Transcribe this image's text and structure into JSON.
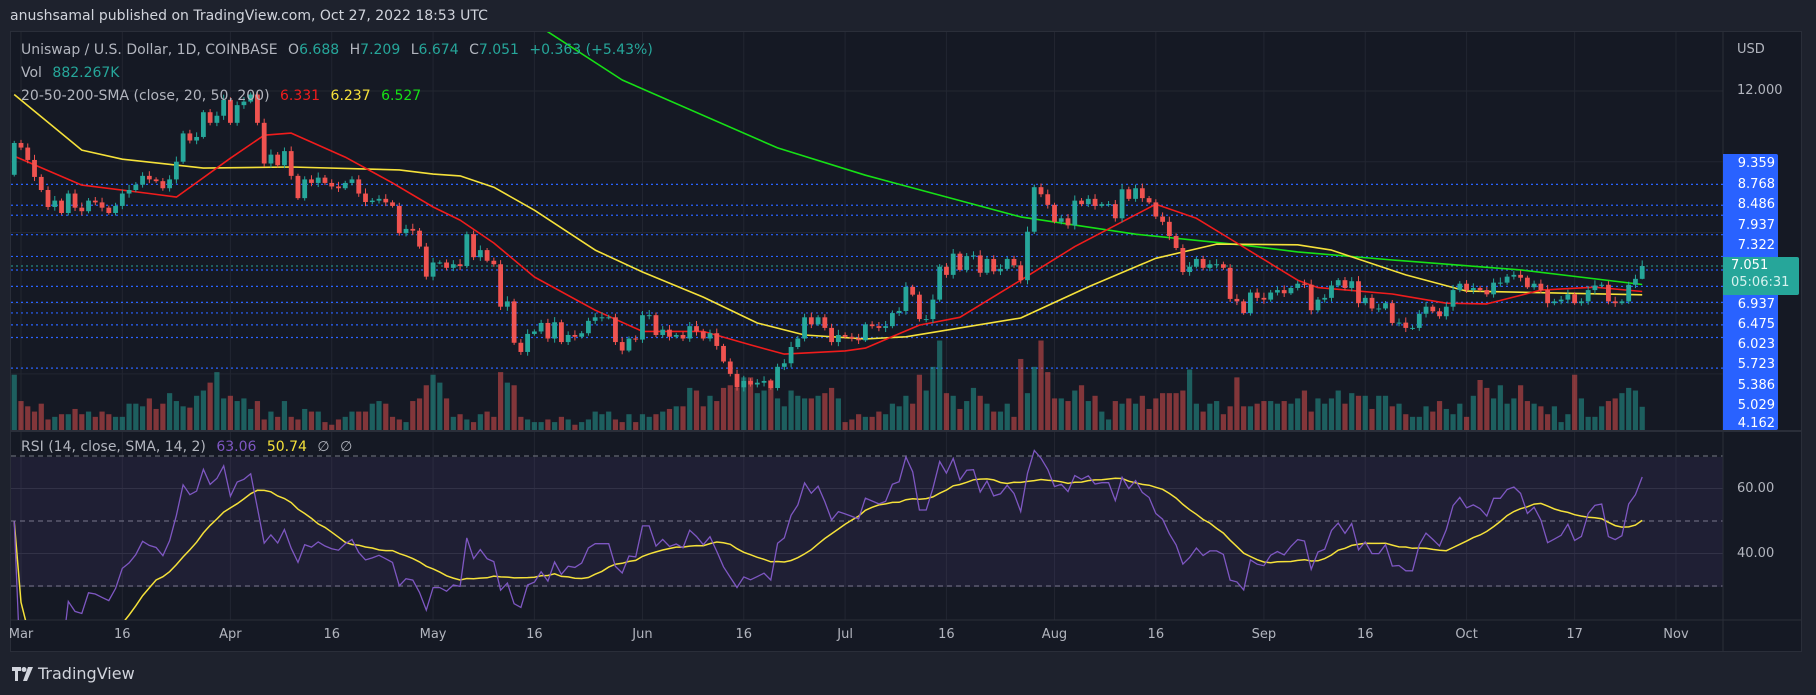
{
  "header": {
    "published": "anushsamal published on TradingView.com, Oct 27, 2022 18:53 UTC"
  },
  "legend": {
    "symbol": "Uniswap / U.S. Dollar, 1D, COINBASE",
    "o_label": "O",
    "o": "6.688",
    "h_label": "H",
    "h": "7.209",
    "l_label": "L",
    "l": "6.674",
    "c_label": "C",
    "c": "7.051",
    "change": "+0.363 (+5.43%)",
    "vol_label": "Vol",
    "vol": "882.267K",
    "sma_label": "20-50-200-SMA (close, 20, 50, 200)",
    "sma20": "6.331",
    "sma50": "6.237",
    "sma200": "6.527",
    "rsi_label": "RSI (14, close, SMA, 14, 2)",
    "rsi": "63.06",
    "rsi_ma": "50.74",
    "rsi_extra1": "∅",
    "rsi_extra2": "∅"
  },
  "price_axis": {
    "currency": "USD",
    "tick": "12.000",
    "line_labels": [
      "9.359",
      "8.768",
      "8.486",
      "7.937",
      "7.322",
      "6.937",
      "6.475",
      "6.023",
      "5.723",
      "5.386",
      "5.029",
      "4.162"
    ],
    "current_price": "7.051",
    "countdown": "05:06:31"
  },
  "rsi_axis": {
    "ticks": [
      "60.00",
      "40.00"
    ]
  },
  "footer": {
    "logo_text": "TradingView"
  },
  "colors": {
    "up": "#26a69a",
    "down": "#ef5350",
    "sma20": "#f01c1c",
    "sma50": "#f5e13a",
    "sma200": "#16e016",
    "rsi": "#7e57c2",
    "rsi_ma": "#f5e13a",
    "hline": "#2962ff"
  },
  "chart_data": {
    "type": "candlestick",
    "title": "Uniswap / U.S. Dollar, 1D, COINBASE",
    "scale": "linear",
    "ylim": [
      2.4,
      13.6
    ],
    "start_date": "2022-02-28",
    "last": {
      "open": 6.688,
      "high": 7.209,
      "low": 6.674,
      "close": 7.051
    },
    "closes": [
      10.53,
      10.4,
      10.05,
      9.57,
      9.2,
      8.72,
      8.9,
      8.55,
      9.1,
      8.7,
      8.6,
      8.9,
      8.85,
      8.7,
      8.55,
      8.75,
      9.1,
      9.2,
      9.35,
      9.6,
      9.5,
      9.45,
      9.25,
      9.5,
      10.0,
      10.8,
      10.6,
      10.7,
      11.4,
      11.1,
      11.3,
      11.75,
      11.1,
      11.6,
      11.7,
      11.9,
      11.1,
      9.95,
      10.2,
      9.9,
      10.3,
      9.6,
      8.97,
      9.5,
      9.4,
      9.55,
      9.4,
      9.3,
      9.25,
      9.4,
      9.5,
      9.1,
      8.86,
      8.9,
      8.95,
      8.85,
      8.75,
      7.98,
      8.1,
      8.05,
      7.6,
      6.75,
      7.15,
      7.15,
      7.0,
      7.1,
      7.05,
      7.95,
      7.3,
      7.5,
      7.2,
      7.1,
      5.9,
      6.05,
      4.88,
      4.62,
      5.13,
      5.2,
      5.44,
      5.0,
      5.46,
      4.9,
      5.1,
      5.05,
      5.15,
      5.5,
      5.6,
      5.6,
      5.6,
      4.9,
      4.66,
      5.0,
      4.97,
      5.66,
      5.66,
      5.1,
      5.25,
      5.05,
      5.1,
      5.0,
      5.35,
      5.2,
      5.0,
      5.15,
      4.79,
      4.35,
      4.0,
      3.62,
      3.8,
      3.7,
      3.75,
      3.8,
      3.6,
      4.2,
      4.3,
      4.76,
      5.0,
      5.6,
      5.4,
      5.6,
      5.3,
      4.9,
      5.1,
      5.05,
      5.0,
      4.95,
      5.4,
      5.35,
      5.3,
      5.35,
      5.72,
      5.78,
      6.46,
      6.24,
      5.55,
      5.55,
      6.1,
      7.03,
      6.8,
      7.4,
      6.94,
      7.33,
      7.35,
      6.86,
      7.25,
      6.9,
      6.97,
      7.25,
      7.07,
      6.65,
      8.02,
      9.28,
      9.08,
      8.78,
      8.3,
      8.4,
      8.2,
      8.9,
      8.8,
      8.95,
      8.75,
      8.8,
      8.8,
      8.4,
      9.22,
      8.95,
      9.25,
      8.97,
      8.85,
      8.45,
      8.3,
      7.9,
      7.56,
      6.88,
      7.03,
      7.25,
      7.0,
      7.1,
      7.1,
      7.0,
      6.12,
      6.05,
      5.72,
      6.3,
      6.15,
      6.1,
      6.3,
      6.37,
      6.28,
      6.43,
      6.55,
      6.52,
      5.8,
      6.1,
      6.15,
      6.5,
      6.65,
      6.43,
      6.62,
      6.0,
      6.15,
      5.85,
      5.85,
      6.0,
      5.44,
      5.45,
      5.3,
      5.3,
      5.7,
      5.9,
      5.77,
      5.63,
      5.9,
      6.37,
      6.55,
      6.37,
      6.43,
      6.37,
      6.25,
      6.58,
      6.58,
      6.75,
      6.8,
      6.72,
      6.45,
      6.55,
      6.37,
      6.0,
      6.05,
      6.1,
      6.25,
      6.0,
      6.05,
      6.37,
      6.5,
      6.52,
      6.05,
      6.0,
      6.05,
      6.52,
      6.688,
      7.051
    ],
    "volume_k": [
      2100,
      1100,
      900,
      700,
      1000,
      400,
      500,
      600,
      600,
      800,
      600,
      700,
      500,
      700,
      600,
      500,
      500,
      1000,
      1000,
      900,
      1200,
      800,
      1000,
      1400,
      1100,
      900,
      850,
      1300,
      1500,
      1800,
      2200,
      1200,
      1300,
      1100,
      1200,
      800,
      1100,
      400,
      700,
      500,
      1100,
      500,
      400,
      800,
      700,
      700,
      300,
      200,
      400,
      500,
      700,
      700,
      700,
      1000,
      1100,
      1000,
      500,
      400,
      300,
      1100,
      1200,
      1700,
      2100,
      1800,
      1200,
      500,
      600,
      400,
      300,
      600,
      700,
      500,
      2200,
      1800,
      1700,
      500,
      400,
      300,
      300,
      400,
      300,
      500,
      400,
      200,
      300,
      400,
      700,
      600,
      700,
      400,
      300,
      600,
      300,
      600,
      500,
      600,
      700,
      800,
      900,
      900,
      1600,
      1500,
      900,
      1300,
      1100,
      1600,
      1700,
      1600,
      2000,
      2000,
      1400,
      1500,
      1900,
      1200,
      900,
      1500,
      1300,
      1200,
      1200,
      1300,
      1400,
      1600,
      1200,
      300,
      400,
      600,
      500,
      500,
      700,
      600,
      1000,
      900,
      1300,
      1000,
      2100,
      1500,
      2400,
      3400,
      1400,
      1300,
      800,
      1100,
      1600,
      1300,
      1000,
      700,
      700,
      1000,
      500,
      2700,
      1400,
      2400,
      3400,
      2200,
      1200,
      1200,
      1100,
      1500,
      1700,
      1100,
      1300,
      700,
      400,
      1100,
      1000,
      1200,
      1000,
      1300,
      800,
      1200,
      1400,
      1400,
      1400,
      1500,
      2300,
      1000,
      700,
      1000,
      1100,
      600,
      900,
      2000,
      900,
      900,
      1000,
      1100,
      1100,
      1000,
      1100,
      1000,
      1200,
      1500,
      700,
      1200,
      1000,
      1200,
      1500,
      1000,
      1400,
      1300,
      1300,
      800,
      1300,
      1300,
      900,
      1000,
      600,
      500,
      500,
      900,
      700,
      1100,
      800,
      600,
      1000,
      500,
      1300,
      1900,
      1600,
      1200,
      1700,
      1000,
      1200,
      1700,
      1100,
      1000,
      900,
      600,
      900,
      300,
      600,
      2100,
      1200,
      500,
      500,
      900,
      1100,
      1200,
      1400,
      1600,
      1500,
      882
    ],
    "sma20": [
      [
        "2022-02-28",
        10.16
      ],
      [
        "2022-03-10",
        9.34
      ],
      [
        "2022-03-20",
        9.1
      ],
      [
        "2022-03-24",
        9.0
      ],
      [
        "2022-04-01",
        10.1
      ],
      [
        "2022-04-06",
        10.75
      ],
      [
        "2022-04-10",
        10.81
      ],
      [
        "2022-04-18",
        10.13
      ],
      [
        "2022-04-25",
        9.4
      ],
      [
        "2022-05-01",
        8.72
      ],
      [
        "2022-05-05",
        8.35
      ],
      [
        "2022-05-10",
        7.7
      ],
      [
        "2022-05-16",
        6.74
      ],
      [
        "2022-05-25",
        5.8
      ],
      [
        "2022-06-01",
        5.2
      ],
      [
        "2022-06-10",
        5.2
      ],
      [
        "2022-06-17",
        4.82
      ],
      [
        "2022-06-22",
        4.56
      ],
      [
        "2022-07-01",
        4.65
      ],
      [
        "2022-07-04",
        4.73
      ],
      [
        "2022-07-12",
        5.38
      ],
      [
        "2022-07-18",
        5.6
      ],
      [
        "2022-07-27",
        6.65
      ],
      [
        "2022-08-04",
        7.6
      ],
      [
        "2022-08-16",
        8.8
      ],
      [
        "2022-08-22",
        8.4
      ],
      [
        "2022-08-28",
        7.7
      ],
      [
        "2022-09-06",
        6.65
      ],
      [
        "2022-09-09",
        6.44
      ],
      [
        "2022-09-20",
        6.26
      ],
      [
        "2022-09-28",
        6.0
      ],
      [
        "2022-10-04",
        5.98
      ],
      [
        "2022-10-12",
        6.37
      ],
      [
        "2022-10-20",
        6.45
      ],
      [
        "2022-10-27",
        6.331
      ]
    ],
    "sma50": [
      [
        "2022-02-28",
        11.9
      ],
      [
        "2022-03-10",
        10.33
      ],
      [
        "2022-03-16",
        10.07
      ],
      [
        "2022-03-28",
        9.82
      ],
      [
        "2022-04-10",
        9.85
      ],
      [
        "2022-04-26",
        9.77
      ],
      [
        "2022-05-01",
        9.65
      ],
      [
        "2022-05-05",
        9.6
      ],
      [
        "2022-05-10",
        9.28
      ],
      [
        "2022-05-16",
        8.63
      ],
      [
        "2022-05-25",
        7.5
      ],
      [
        "2022-06-01",
        6.88
      ],
      [
        "2022-06-10",
        6.17
      ],
      [
        "2022-06-18",
        5.44
      ],
      [
        "2022-06-25",
        5.1
      ],
      [
        "2022-07-04",
        4.99
      ],
      [
        "2022-07-10",
        5.05
      ],
      [
        "2022-07-27",
        5.58
      ],
      [
        "2022-08-06",
        6.46
      ],
      [
        "2022-08-16",
        7.27
      ],
      [
        "2022-08-25",
        7.67
      ],
      [
        "2022-09-06",
        7.65
      ],
      [
        "2022-09-11",
        7.5
      ],
      [
        "2022-09-22",
        6.8
      ],
      [
        "2022-10-01",
        6.34
      ],
      [
        "2022-10-27",
        6.237
      ]
    ],
    "sma200": [
      [
        "2022-05-17",
        13.8
      ],
      [
        "2022-05-29",
        12.31
      ],
      [
        "2022-06-21",
        10.39
      ],
      [
        "2022-07-04",
        9.62
      ],
      [
        "2022-07-27",
        8.44
      ],
      [
        "2022-08-13",
        7.95
      ],
      [
        "2022-08-29",
        7.64
      ],
      [
        "2022-09-06",
        7.45
      ],
      [
        "2022-09-20",
        7.22
      ],
      [
        "2022-10-09",
        6.94
      ],
      [
        "2022-10-27",
        6.527
      ]
    ],
    "horizontal_lines": [
      9.359,
      8.768,
      8.486,
      7.937,
      7.322,
      6.937,
      6.475,
      6.023,
      5.723,
      5.386,
      5.029,
      4.162
    ],
    "grid_prices": [
      12,
      10,
      8,
      6,
      4
    ],
    "rsi": {
      "period": 14,
      "ma_period": 14,
      "levels": [
        70,
        50,
        30
      ],
      "ticks": [
        60,
        40
      ],
      "last": 63.06,
      "last_ma": 50.74
    },
    "x_ticks": [
      {
        "label": "Mar",
        "date": "2022-03-01"
      },
      {
        "label": "16",
        "date": "2022-03-16"
      },
      {
        "label": "Apr",
        "date": "2022-04-01"
      },
      {
        "label": "16",
        "date": "2022-04-16"
      },
      {
        "label": "May",
        "date": "2022-05-01"
      },
      {
        "label": "16",
        "date": "2022-05-16"
      },
      {
        "label": "Jun",
        "date": "2022-06-01"
      },
      {
        "label": "16",
        "date": "2022-06-16"
      },
      {
        "label": "Jul",
        "date": "2022-07-01"
      },
      {
        "label": "16",
        "date": "2022-07-16"
      },
      {
        "label": "Aug",
        "date": "2022-08-01"
      },
      {
        "label": "16",
        "date": "2022-08-16"
      },
      {
        "label": "Sep",
        "date": "2022-09-01"
      },
      {
        "label": "16",
        "date": "2022-09-16"
      },
      {
        "label": "Oct",
        "date": "2022-10-01"
      },
      {
        "label": "17",
        "date": "2022-10-17"
      },
      {
        "label": "Nov",
        "date": "2022-11-01"
      }
    ]
  }
}
